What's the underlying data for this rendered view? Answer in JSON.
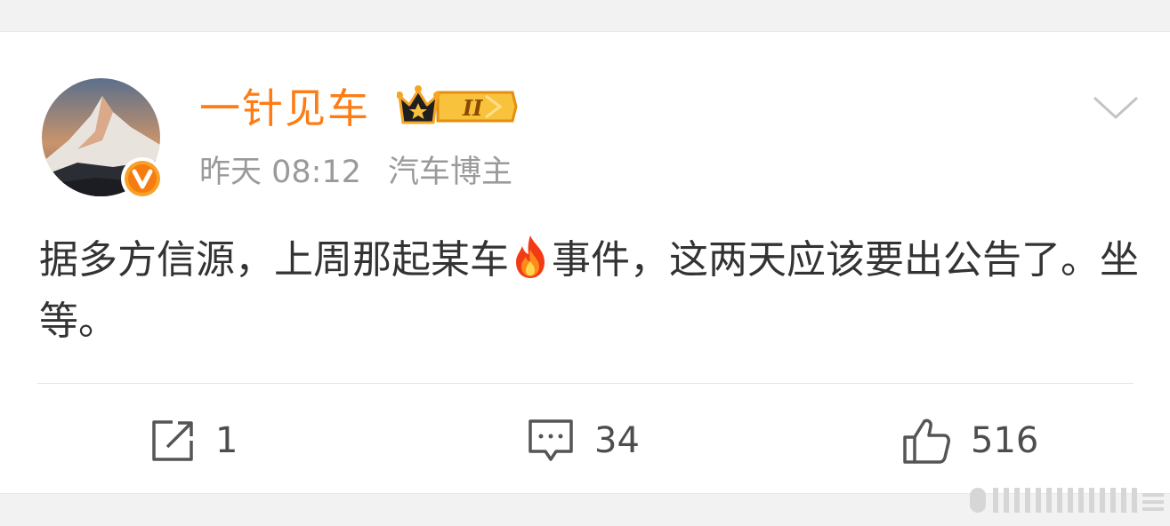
{
  "post": {
    "username": "一针见车",
    "level_badge": "II",
    "time": "昨天 08:12",
    "category": "汽车博主",
    "text_before_emoji": "据多方信源，上周那起某车",
    "emoji": "fire-icon",
    "text_after_emoji": "事件，这两天应该要出公告了。坐等。"
  },
  "actions": {
    "repost_count": "1",
    "comment_count": "34",
    "like_count": "516"
  },
  "colors": {
    "username": "#ff7c14",
    "meta": "#9a9a9a",
    "text": "#333333",
    "background": "#f2f2f2",
    "badge_gold": "#f5a623",
    "verified_orange": "#f77c0f"
  }
}
